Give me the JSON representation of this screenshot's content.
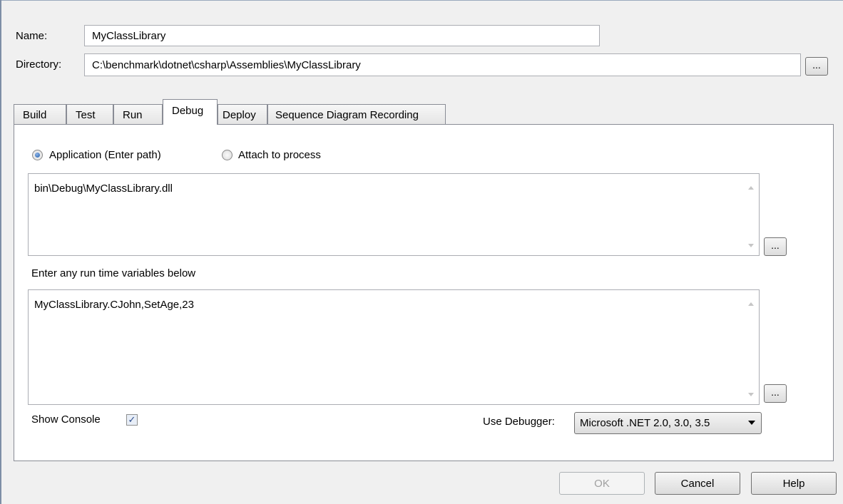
{
  "name_label": "Name:",
  "name_value": "MyClassLibrary",
  "directory_label": "Directory:",
  "directory_value": "C:\\benchmark\\dotnet\\csharp\\Assemblies\\MyClassLibrary",
  "browse_label": "...",
  "tabs": [
    "Build",
    "Test",
    "Run",
    "Debug",
    "Deploy",
    "Sequence Diagram Recording"
  ],
  "active_tab": "Debug",
  "debug": {
    "radio_application": "Application (Enter path)",
    "radio_attach": "Attach to process",
    "application_selected": true,
    "path_value": "bin\\Debug\\MyClassLibrary.dll",
    "runtime_label": "Enter any run time variables below",
    "runtime_value": "MyClassLibrary.CJohn,SetAge,23",
    "show_console_label": "Show Console",
    "show_console_checked": true,
    "use_debugger_label": "Use Debugger:",
    "debugger_value": "Microsoft .NET 2.0, 3.0, 3.5"
  },
  "buttons": {
    "ok": "OK",
    "cancel": "Cancel",
    "help": "Help"
  },
  "check_glyph": "✓",
  "colors": {
    "frame": "#7d8ea6",
    "radio_selected": "#1d5aa8",
    "disabled_text": "#a0a0a0"
  }
}
